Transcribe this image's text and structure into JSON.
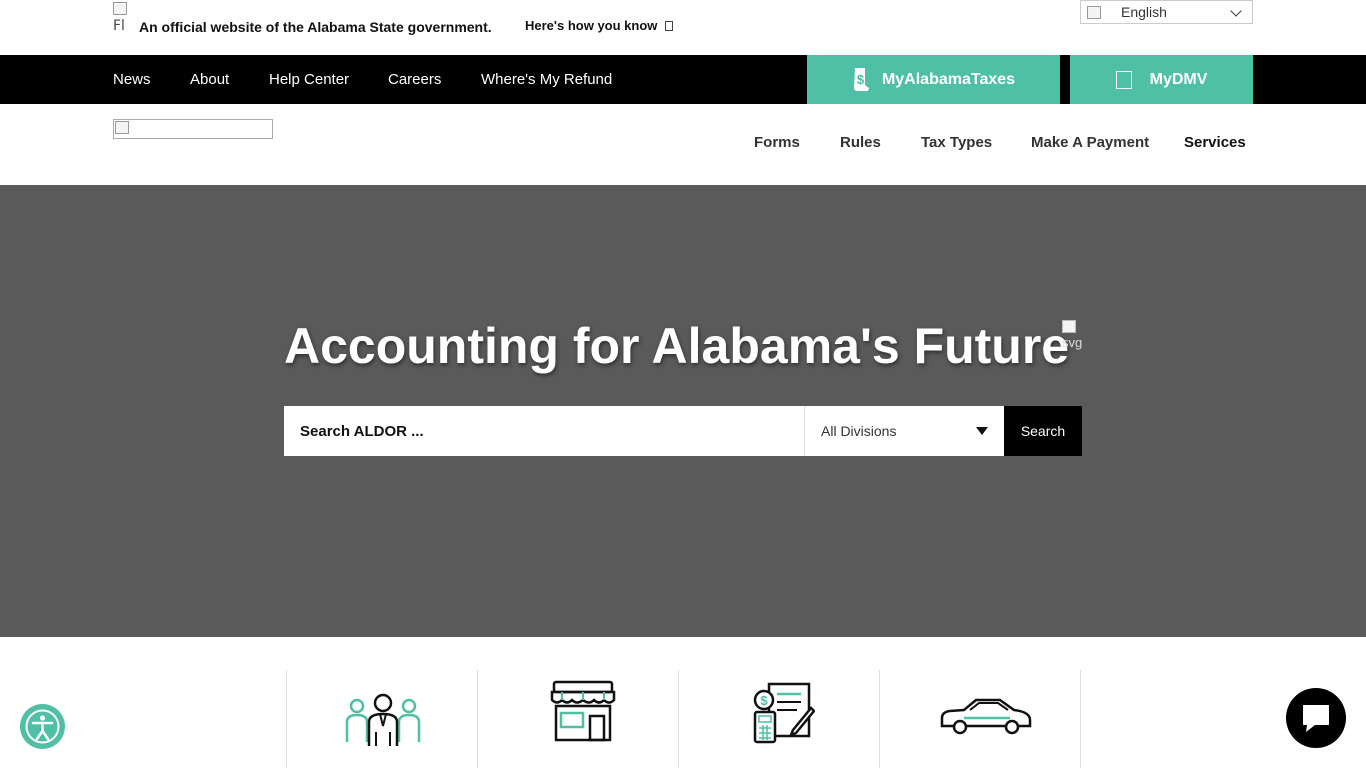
{
  "banner": {
    "flag_alt": "Fl",
    "official_text": "An official website of the Alabama State government.",
    "how_you_know": "Here's how you know",
    "language": "English"
  },
  "topnav": {
    "items": [
      "News",
      "About",
      "Help Center",
      "Careers",
      "Where's My Refund"
    ],
    "my_alabama_taxes": "MyAlabamaTaxes",
    "mydmv": "MyDMV"
  },
  "mainnav": {
    "items": [
      "Forms",
      "Rules",
      "Tax Types",
      "Make A Payment",
      "Services"
    ]
  },
  "hero": {
    "title": "Accounting for Alabama's Future",
    "image_alt": "svg",
    "search_placeholder": "Search ALDOR ...",
    "division_selected": "All Divisions",
    "search_button": "Search"
  },
  "tiles": [
    {
      "icon": "people-icon"
    },
    {
      "icon": "storefront-icon"
    },
    {
      "icon": "tax-document-icon"
    },
    {
      "icon": "car-icon"
    }
  ],
  "colors": {
    "accent": "#4fbfa5",
    "hero_bg": "#5a5a5a",
    "nav_bg": "#000000"
  }
}
